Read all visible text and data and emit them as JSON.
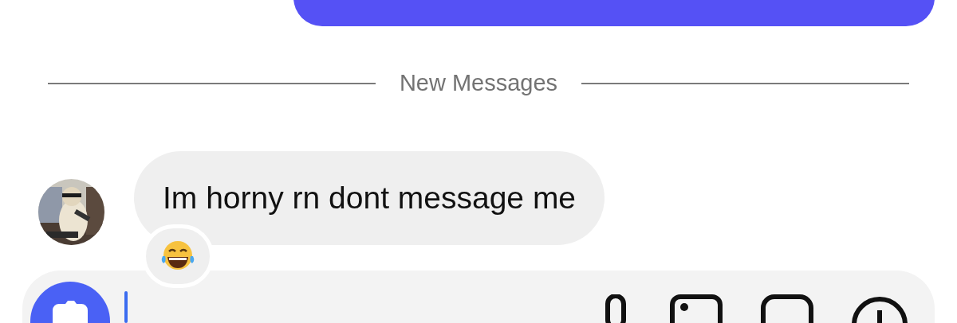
{
  "divider": {
    "label": "New Messages"
  },
  "messages": [
    {
      "kind": "received",
      "text": "Im horny rn dont message me",
      "reaction": {
        "kind": "laughing"
      }
    }
  ]
}
